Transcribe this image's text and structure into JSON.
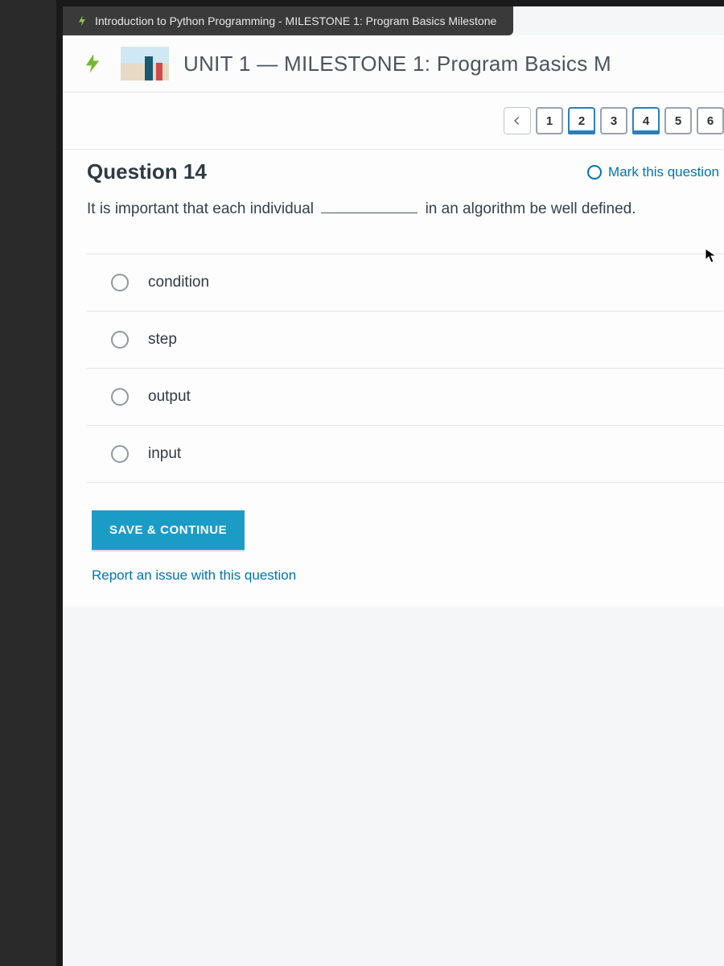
{
  "tab": {
    "title": "Introduction to Python Programming - MILESTONE 1: Program Basics Milestone"
  },
  "unit": {
    "title": "UNIT 1 — MILESTONE 1: Program Basics M"
  },
  "nav": {
    "items": [
      "1",
      "2",
      "3",
      "4",
      "5",
      "6"
    ],
    "answered": [
      false,
      true,
      false,
      true,
      false,
      false
    ]
  },
  "question": {
    "title": "Question 14",
    "mark_label": "Mark this question",
    "stem_before": "It is important that each individual",
    "stem_after": "in an algorithm be well defined.",
    "options": [
      "condition",
      "step",
      "output",
      "input"
    ],
    "save_label": "SAVE & CONTINUE",
    "report_label": "Report an issue with this question"
  }
}
